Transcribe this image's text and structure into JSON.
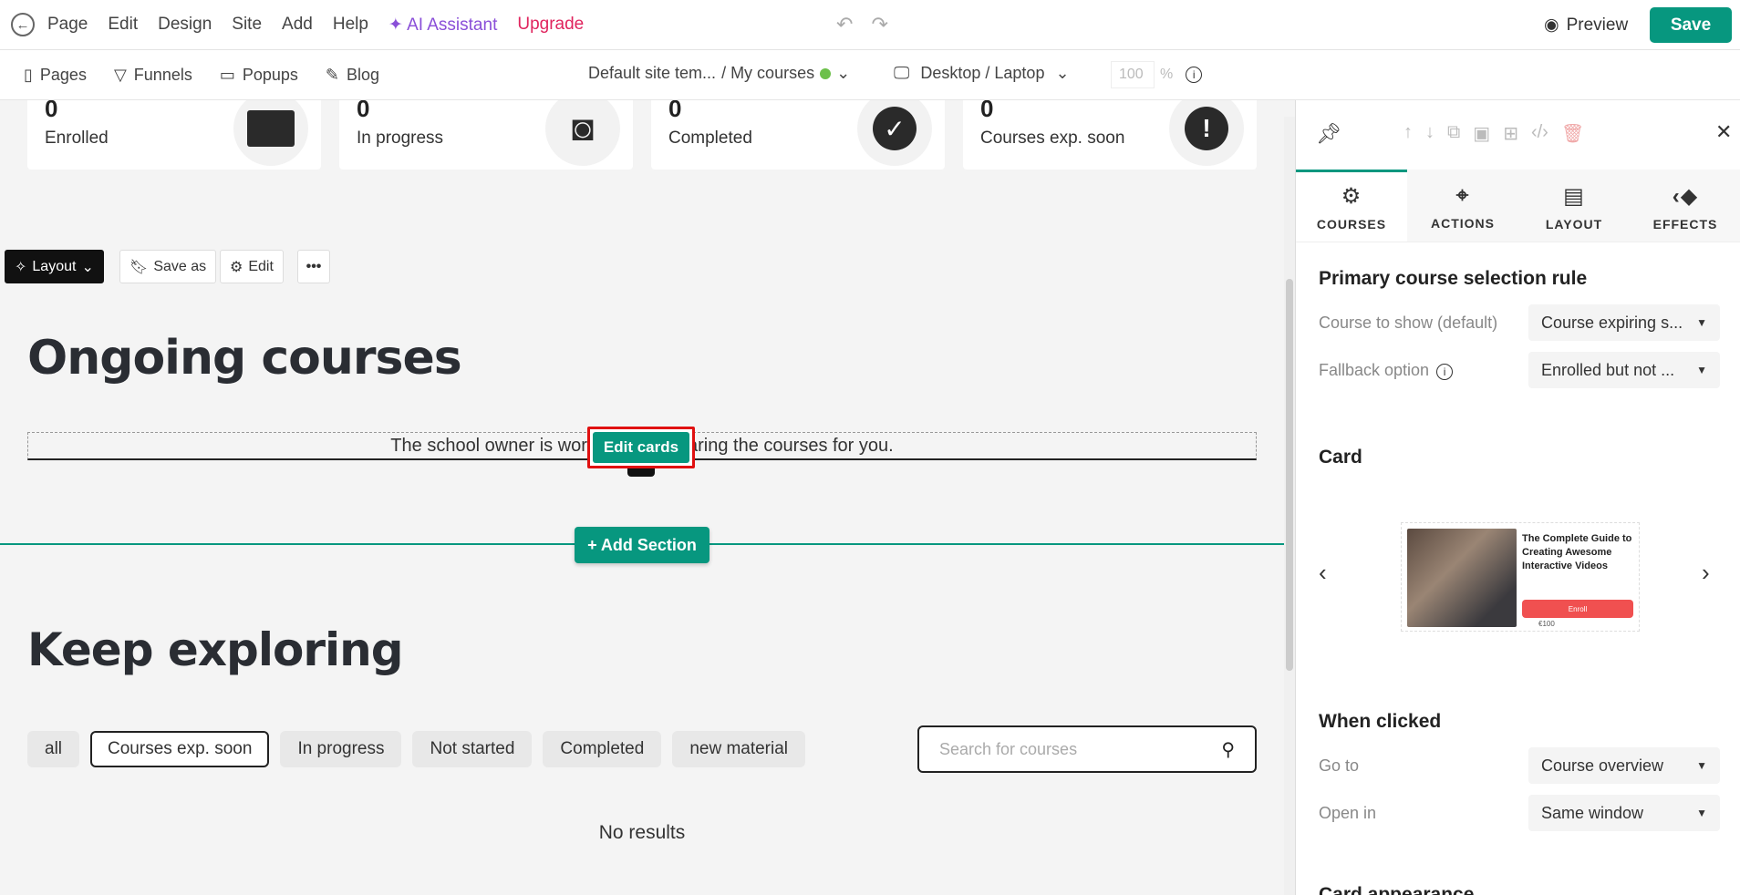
{
  "topbar": {
    "menu": [
      "Page",
      "Edit",
      "Design",
      "Site",
      "Add",
      "Help"
    ],
    "ai_label": "AI Assistant",
    "upgrade_label": "Upgrade",
    "preview_label": "Preview",
    "save_label": "Save"
  },
  "subbar": {
    "nav": [
      "Pages",
      "Funnels",
      "Popups",
      "Blog"
    ],
    "template_label": "Default site tem...",
    "page_label": "/ My courses",
    "device_label": "Desktop / Laptop",
    "zoom_value": "100",
    "zoom_unit": "%"
  },
  "stats": [
    {
      "num": "0",
      "label": "Enrolled"
    },
    {
      "num": "0",
      "label": "In progress"
    },
    {
      "num": "0",
      "label": "Completed"
    },
    {
      "num": "0",
      "label": "Courses exp. soon"
    }
  ],
  "section_toolbar": {
    "layout_label": "Layout",
    "saveas_label": "Save as",
    "edit_label": "Edit",
    "more_label": "•••"
  },
  "ongoing": {
    "heading": "Ongoing courses",
    "placeholder_text": "The school owner is working on preparing the courses for you.",
    "edit_cards_label": "Edit cards"
  },
  "add_section_label": "+ Add Section",
  "explore": {
    "heading": "Keep exploring",
    "filters": [
      "all",
      "Courses exp. soon",
      "In progress",
      "Not started",
      "Completed",
      "new material"
    ],
    "active_filter": "Courses exp. soon",
    "search_placeholder": "Search for courses",
    "no_results": "No results"
  },
  "panel": {
    "tabs": [
      "COURSES",
      "ACTIONS",
      "LAYOUT",
      "EFFECTS"
    ],
    "active_tab": "COURSES",
    "primary_rule_title": "Primary course selection rule",
    "course_to_show_label": "Course to show (default)",
    "course_to_show_value": "Course expiring s...",
    "fallback_label": "Fallback option",
    "fallback_value": "Enrolled but not ...",
    "card_title": "Card",
    "card_preview_title": "The Complete Guide to Creating Awesome Interactive Videos",
    "card_preview_button": "Enroll",
    "card_preview_price": "€100",
    "when_clicked_title": "When clicked",
    "goto_label": "Go to",
    "goto_value": "Course overview",
    "openin_label": "Open in",
    "openin_value": "Same window",
    "card_appearance_title": "Card appearance"
  }
}
